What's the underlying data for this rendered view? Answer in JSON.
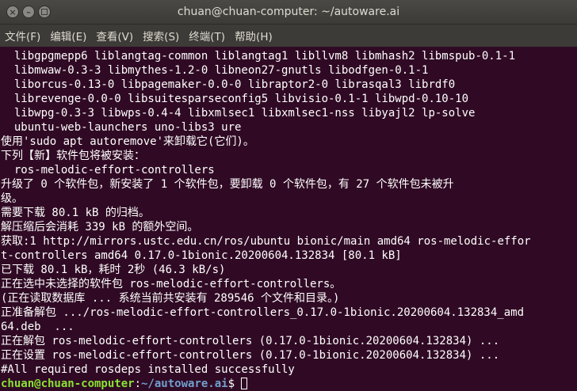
{
  "window": {
    "title": "chuan@chuan-computer: ~/autoware.ai"
  },
  "menu": {
    "items": [
      "文件(F)",
      "编辑(E)",
      "查看(V)",
      "搜索(S)",
      "终端(T)",
      "帮助(H)"
    ]
  },
  "terminal": {
    "lines": [
      "  libgpgmepp6 liblangtag-common liblangtag1 libllvm8 libmhash2 libmspub-0.1-1",
      "  libmwaw-0.3-3 libmythes-1.2-0 libneon27-gnutls libodfgen-0.1-1",
      "  liborcus-0.13-0 libpagemaker-0.0-0 libraptor2-0 librasqal3 librdf0",
      "  librevenge-0.0-0 libsuitesparseconfig5 libvisio-0.1-1 libwpd-0.10-10",
      "  libwpg-0.3-3 libwps-0.4-4 libxmlsec1 libxmlsec1-nss libyajl2 lp-solve",
      "  ubuntu-web-launchers uno-libs3 ure",
      "使用'sudo apt autoremove'来卸载它(它们)。",
      "下列【新】软件包将被安装：",
      "  ros-melodic-effort-controllers",
      "升级了 0 个软件包，新安装了 1 个软件包，要卸载 0 个软件包，有 27 个软件包未被升",
      "级。",
      "需要下载 80.1 kB 的归档。",
      "解压缩后会消耗 339 kB 的额外空间。",
      "获取:1 http://mirrors.ustc.edu.cn/ros/ubuntu bionic/main amd64 ros-melodic-effor",
      "t-controllers amd64 0.17.0-1bionic.20200604.132834 [80.1 kB]",
      "已下载 80.1 kB，耗时 2秒 (46.3 kB/s)",
      "正在选中未选择的软件包 ros-melodic-effort-controllers。",
      "(正在读取数据库 ... 系统当前共安装有 289546 个文件和目录。)",
      "正准备解包 .../ros-melodic-effort-controllers_0.17.0-1bionic.20200604.132834_amd",
      "64.deb  ...",
      "正在解包 ros-melodic-effort-controllers (0.17.0-1bionic.20200604.132834) ...",
      "正在设置 ros-melodic-effort-controllers (0.17.0-1bionic.20200604.132834) ...",
      "#All required rosdeps installed successfully"
    ],
    "prompt": {
      "user_host": "chuan@chuan-computer",
      "separator": ":",
      "path": "~/autoware.ai",
      "symbol": "$ "
    }
  },
  "colors": {
    "background": "#300a24",
    "text": "#ffffff",
    "prompt_user": "#8ae234",
    "prompt_path": "#729fcf",
    "titlebar": "#3c3b37"
  }
}
